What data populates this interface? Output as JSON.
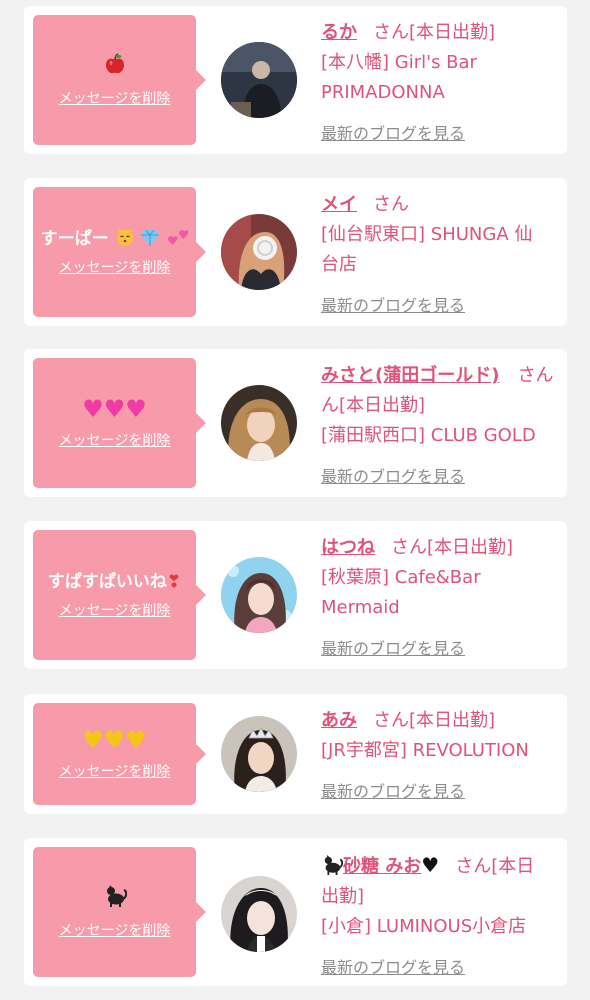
{
  "delete_label": "メッセージを削除",
  "san_label": "さん",
  "blog_label": "最新のブログを見る",
  "colors": {
    "page_bg": "#f2f2f2",
    "bubble_bg": "#f79aa9",
    "name_pink": "#e0527a",
    "link_gray": "#8c8c8c"
  },
  "cards": [
    {
      "message_text": "",
      "message_icons": [
        "apple-icon"
      ],
      "name": "るか",
      "san_suffix": "[本日出勤]",
      "shop_line1": "[本八幡] Girl's Bar",
      "shop_line2": "PRIMADONNA"
    },
    {
      "message_text": "すーぱー",
      "message_icons": [
        "kissing-cat-icon",
        "gem-icon",
        "two-hearts-icon"
      ],
      "name": "メイ",
      "san_suffix": "",
      "shop_line1": "[仙台駅東口] SHUNGA 仙",
      "shop_line2": "台店"
    },
    {
      "message_text": "",
      "message_icons": [
        "pink-heart-icon",
        "pink-heart-icon",
        "pink-heart-icon"
      ],
      "name": "みさと(蒲田ゴールド)",
      "name_line2": "ん[本日出勤]",
      "shop_line1": "[蒲田駅西口] CLUB GOLD",
      "shop_line2": ""
    },
    {
      "message_text": "すぱすぱいいね",
      "message_icons": [
        "heart-exclamation-icon"
      ],
      "name": "はつね",
      "san_suffix": "[本日出勤]",
      "shop_line1": "[秋葉原] Cafe&Bar",
      "shop_line2": "Mermaid"
    },
    {
      "message_text": "",
      "message_icons": [
        "yellow-heart-icon",
        "yellow-heart-icon",
        "yellow-heart-icon"
      ],
      "name": "あみ",
      "san_suffix": "[本日出勤]",
      "shop_line1": "[JR宇都宮] REVOLUTION",
      "shop_line2": ""
    },
    {
      "message_text": "",
      "message_icons": [
        "black-cat-icon"
      ],
      "name": "砂糖 みお",
      "name_prefix_icon": "black-cat-icon",
      "name_suffix_icon": "black-heart-icon",
      "san_suffix": "[本日",
      "name_line2": "出勤]",
      "shop_line1": "[小倉] LUMINOUS小倉店",
      "shop_line2": ""
    }
  ]
}
